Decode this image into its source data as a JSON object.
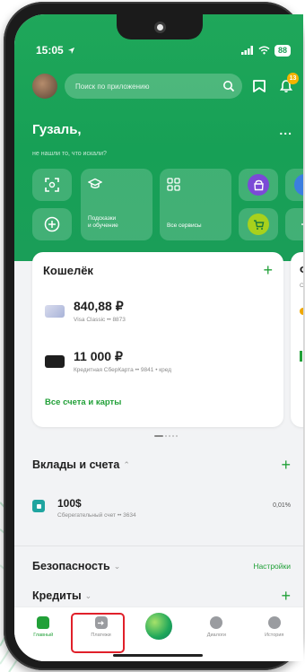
{
  "status": {
    "time": "15:05",
    "battery": "88"
  },
  "search": {
    "placeholder": "Поиск по приложению"
  },
  "notifications": {
    "badge": "13"
  },
  "greeting": {
    "title": "Гузаль,",
    "subtitle": "не нашли то, что искали?",
    "more": "..."
  },
  "tiles": {
    "hints_label_1": "Подсказки",
    "hints_label_2": "и обучение",
    "services_label": "Все сервисы"
  },
  "wallet": {
    "title": "Кошелёк",
    "add": "+",
    "accounts": [
      {
        "amount": "840,88 ₽",
        "sub": "Visa Classic •• 8873"
      },
      {
        "amount": "11 000 ₽",
        "sub": "Кредитная СберКарта •• 9841 • кред"
      }
    ],
    "all_link": "Все счета и карты"
  },
  "side_card": {
    "title": "Ф",
    "sub": "Се"
  },
  "deposits": {
    "title": "Вклады и счета",
    "add": "+",
    "item": {
      "amount": "100$",
      "sub": "Сберегательный счет •• 3634",
      "rate": "0,01%"
    }
  },
  "security": {
    "title": "Безопасность",
    "action": "Настройки"
  },
  "credits": {
    "title": "Кредиты",
    "add": "+"
  },
  "nav": {
    "home": "Главный",
    "payments": "Платежи",
    "dialogs": "Диалоги",
    "history": "История"
  },
  "colors": {
    "green": "#1fa75a",
    "accent": "#21a038",
    "highlight": "#e0202a"
  }
}
